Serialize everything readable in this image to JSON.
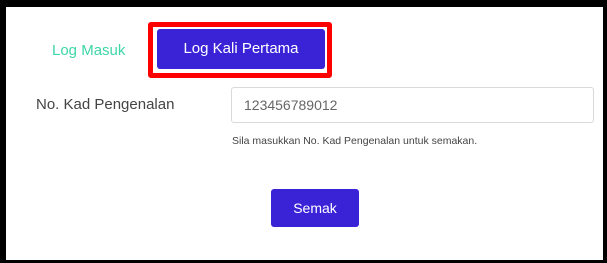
{
  "tabs": {
    "login_label": "Log Masuk",
    "first_login_label": "Log Kali Pertama",
    "active": "first_login",
    "highlight_color": "#ff0000"
  },
  "form": {
    "ic_label": "No. Kad Pengenalan",
    "ic_value": "123456789012",
    "help_text": "Sila masukkan No. Kad Pengenalan untuk semakan."
  },
  "actions": {
    "submit_label": "Semak"
  },
  "colors": {
    "accent": "#3a23d6",
    "inactive_tab": "#3dd6a8"
  }
}
